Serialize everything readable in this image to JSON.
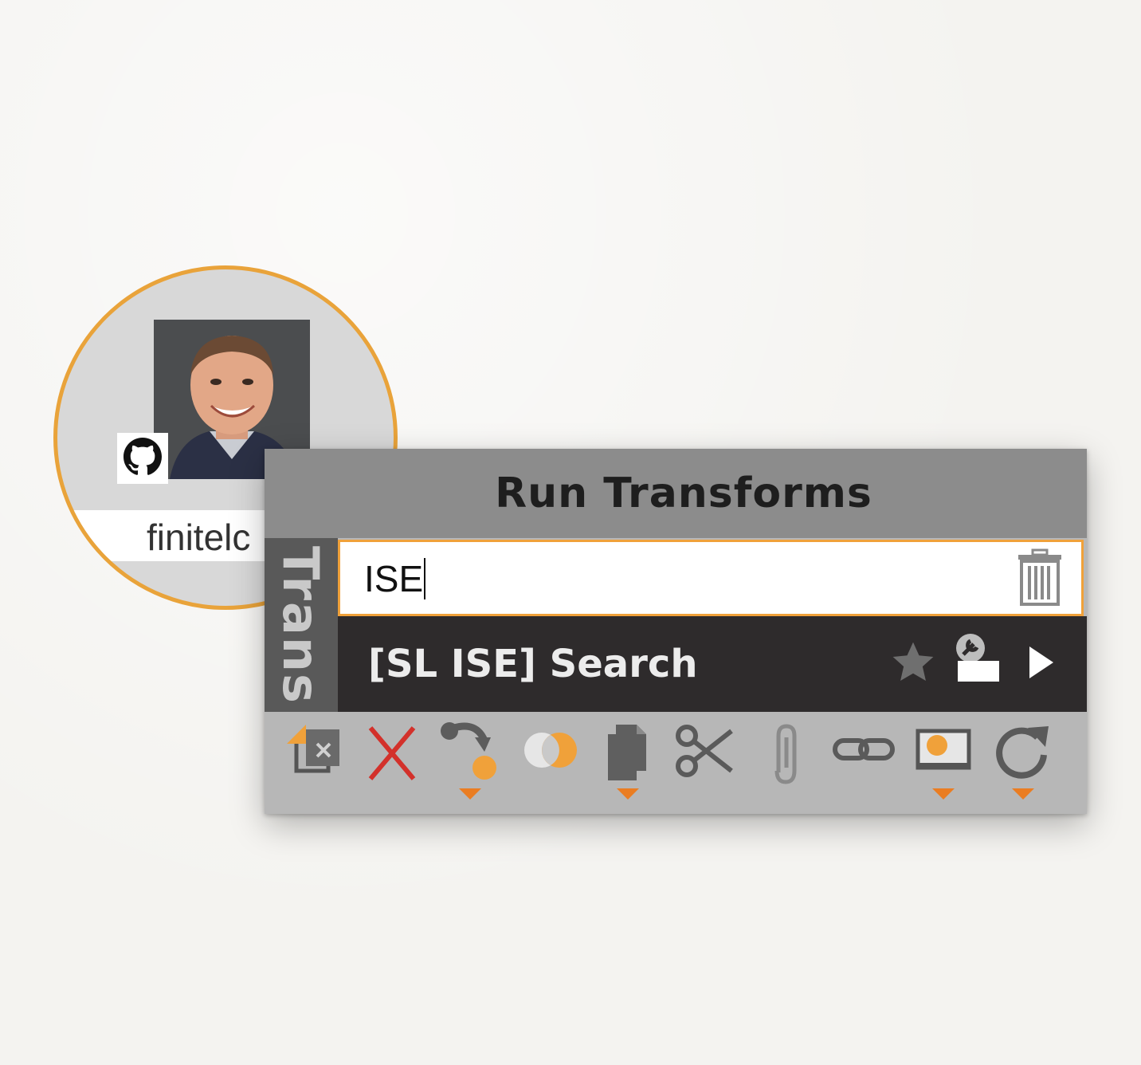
{
  "entity": {
    "label": "finitelc",
    "badge_icon": "github-icon",
    "ring_color": "#e9a33a"
  },
  "panel": {
    "title": "Run Transforms",
    "side_tab_label": "Trans",
    "search": {
      "value": "ISE",
      "clear_icon": "trash-icon"
    },
    "result": {
      "label": "[SL ISE] Search",
      "icons": [
        "star-icon",
        "transform-settings-icon",
        "play-icon"
      ]
    },
    "toolbar": {
      "tools": [
        {
          "icon": "change-type-icon",
          "dropdown": false
        },
        {
          "icon": "delete-icon",
          "dropdown": false
        },
        {
          "icon": "select-links-icon",
          "dropdown": true
        },
        {
          "icon": "merge-icon",
          "dropdown": false
        },
        {
          "icon": "copy-icon",
          "dropdown": true
        },
        {
          "icon": "cut-icon",
          "dropdown": false
        },
        {
          "icon": "attach-icon",
          "dropdown": false
        },
        {
          "icon": "link-icon",
          "dropdown": false
        },
        {
          "icon": "view-icon",
          "dropdown": true
        },
        {
          "icon": "refresh-icon",
          "dropdown": true
        }
      ]
    },
    "accent_color": "#f0a13a",
    "dropdown_color": "#ea7d22"
  }
}
